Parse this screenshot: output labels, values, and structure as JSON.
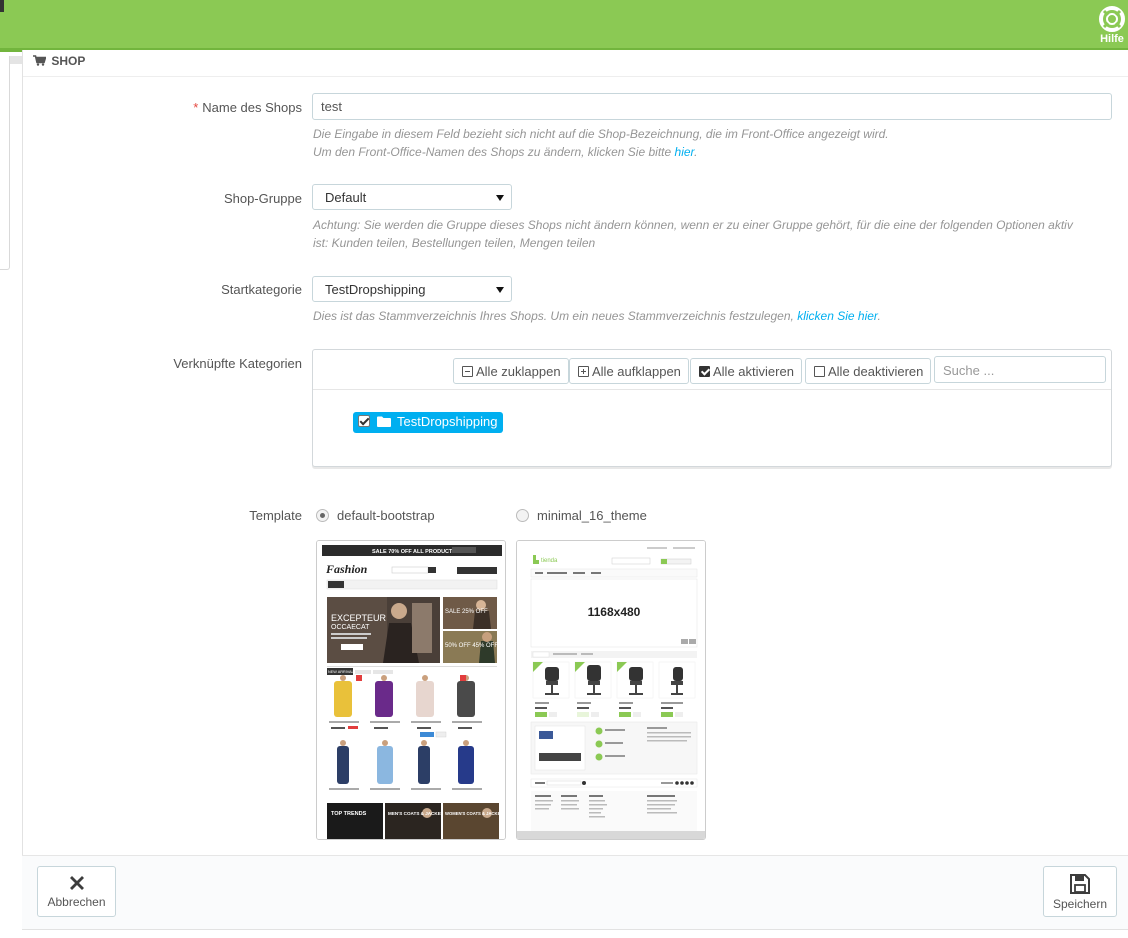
{
  "topbar": {
    "help_label": "Hilfe"
  },
  "panel": {
    "heading": "SHOP"
  },
  "form": {
    "shop_name": {
      "label": "Name des Shops",
      "required_mark": "*",
      "value": "test",
      "help_line1": "Die Eingabe in diesem Feld bezieht sich nicht auf die Shop-Bezeichnung, die im Front-Office angezeigt wird.",
      "help_line2": "Um den Front-Office-Namen des Shops zu ändern, klicken Sie bitte",
      "help_link": "hier",
      "help_end": "."
    },
    "shop_group": {
      "label": "Shop-Gruppe",
      "selected": "Default",
      "help_line1": "Achtung: Sie werden die Gruppe dieses Shops nicht ändern können, wenn er zu einer Gruppe gehört, für die eine der folgenden Optionen aktiv",
      "help_line2": "ist: Kunden teilen, Bestellungen teilen, Mengen teilen"
    },
    "start_category": {
      "label": "Startkategorie",
      "selected": "TestDropshipping",
      "help_text": "Dies ist das Stammverzeichnis Ihres Shops. Um ein neues Stammverzeichnis festzulegen,",
      "help_link": "klicken Sie hier",
      "help_end": "."
    },
    "linked_categories": {
      "label": "Verknüpfte Kategorien",
      "collapse_all": "Alle zuklappen",
      "expand_all": "Alle aufklappen",
      "check_all": "Alle aktivieren",
      "uncheck_all": "Alle deaktivieren",
      "search_placeholder": "Suche ...",
      "tree_node": "TestDropshipping"
    },
    "template": {
      "label": "Template",
      "options": [
        {
          "name": "default-bootstrap",
          "selected": true
        },
        {
          "name": "minimal_16_theme",
          "selected": false
        }
      ],
      "preview1": {
        "banner": "SALE 70% OFF ALL PRODUCTS",
        "logo": "Fashion",
        "hero_title": "EXCEPTEUR",
        "hero_sub": "OCCAECAT",
        "side_promo1": "SALE 25% OFF",
        "side_promo2": "50% OFF 45% OFF",
        "tab": "NEW ARRIVALS",
        "promo_top": "TOP TRENDS",
        "promo_men": "MEN'S COATS & JACKETS",
        "promo_women": "WOMEN'S COATS & JACKETS"
      },
      "preview2": {
        "logo": "tienda",
        "slider_size": "1168x480"
      }
    }
  },
  "footer": {
    "cancel_label": "Abbrechen",
    "save_label": "Speichern"
  },
  "colors": {
    "topbar": "#8bc954",
    "link": "#00aff0",
    "required": "#e5473f"
  }
}
